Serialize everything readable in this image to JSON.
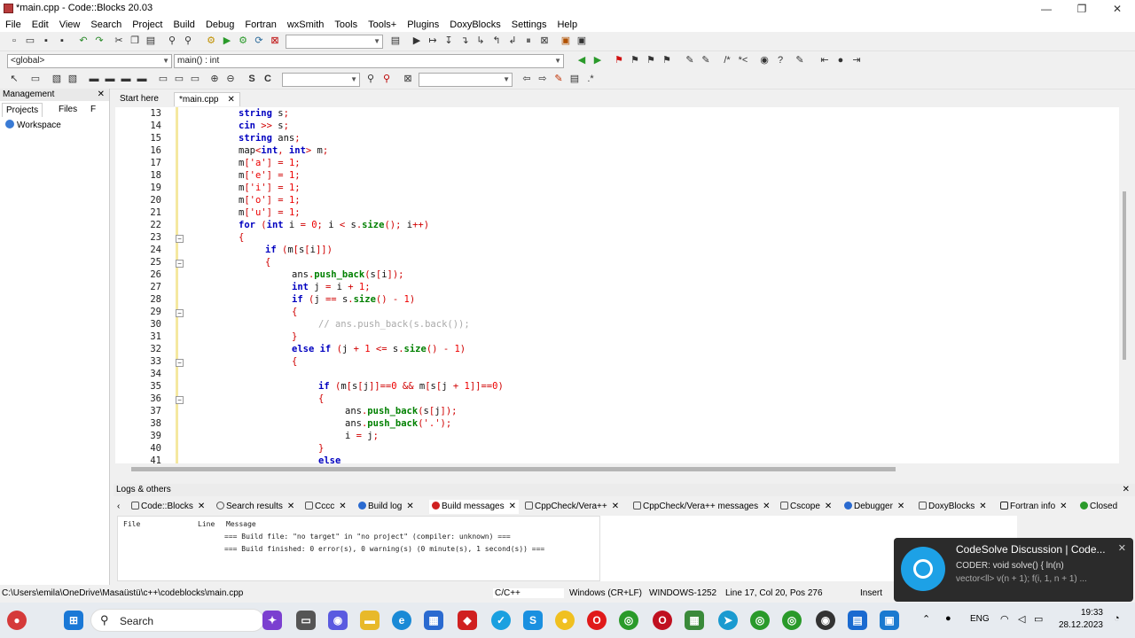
{
  "window": {
    "title": "*main.cpp - Code::Blocks 20.03",
    "minimize": "—",
    "maximize": "❐",
    "close": "✕"
  },
  "menu": [
    "File",
    "Edit",
    "View",
    "Search",
    "Project",
    "Build",
    "Debug",
    "Fortran",
    "wxSmith",
    "Tools",
    "Tools+",
    "Plugins",
    "DoxyBlocks",
    "Settings",
    "Help"
  ],
  "toolbar": {
    "scope_combo": "<global>",
    "function_combo": "main() : int"
  },
  "management": {
    "title": "Management",
    "close": "✕",
    "tabs": [
      "Projects",
      "Files",
      "F"
    ],
    "workspace": "Workspace"
  },
  "editor_tabs": {
    "start_here": "Start here",
    "main_cpp": "*main.cpp",
    "close": "✕"
  },
  "code": {
    "line_numbers": [
      "13",
      "14",
      "15",
      "16",
      "17",
      "18",
      "19",
      "20",
      "21",
      "22",
      "23",
      "24",
      "25",
      "26",
      "27",
      "28",
      "29",
      "30",
      "31",
      "32",
      "33",
      "34",
      "35",
      "36",
      "37",
      "38",
      "39",
      "40",
      "41"
    ]
  },
  "logs": {
    "title": "Logs & others",
    "close": "✕",
    "tabs": [
      "Code::Blocks",
      "Search results",
      "Cccc",
      "Build log",
      "Build messages",
      "CppCheck/Vera++",
      "CppCheck/Vera++ messages",
      "Cscope",
      "Debugger",
      "DoxyBlocks",
      "Fortran info",
      "Closed"
    ],
    "columns": [
      "File",
      "Line",
      "Message"
    ],
    "messages": [
      "=== Build file: \"no target\" in \"no project\" (compiler: unknown) ===",
      "=== Build finished: 0 error(s), 0 warning(s) (0 minute(s), 1 second(s)) ==="
    ]
  },
  "statusbar": {
    "path": "C:\\Users\\emila\\OneDrive\\Masaüstü\\c++\\codeblocks\\main.cpp",
    "language": "C/C++",
    "eol": "Windows (CR+LF)",
    "encoding": "WINDOWS-1252",
    "position": "Line 17, Col 20, Pos 276",
    "mode": "Insert"
  },
  "taskbar": {
    "search": "Search",
    "lang": "ENG",
    "time": "19:33",
    "date": "28.12.2023"
  },
  "notification": {
    "title": "CodeSolve Discussion | Code...",
    "line1": "CODER: void solve() {     ln(n)",
    "line2": "vector<ll> v(n + 1);    f(i, 1, n + 1) ...",
    "close": "✕"
  },
  "colors": {
    "keyword": "#0000c0",
    "number": "#ee0000",
    "function": "#008000",
    "comment": "#aaaaaa",
    "toast_bg": "#2b2b2b"
  }
}
